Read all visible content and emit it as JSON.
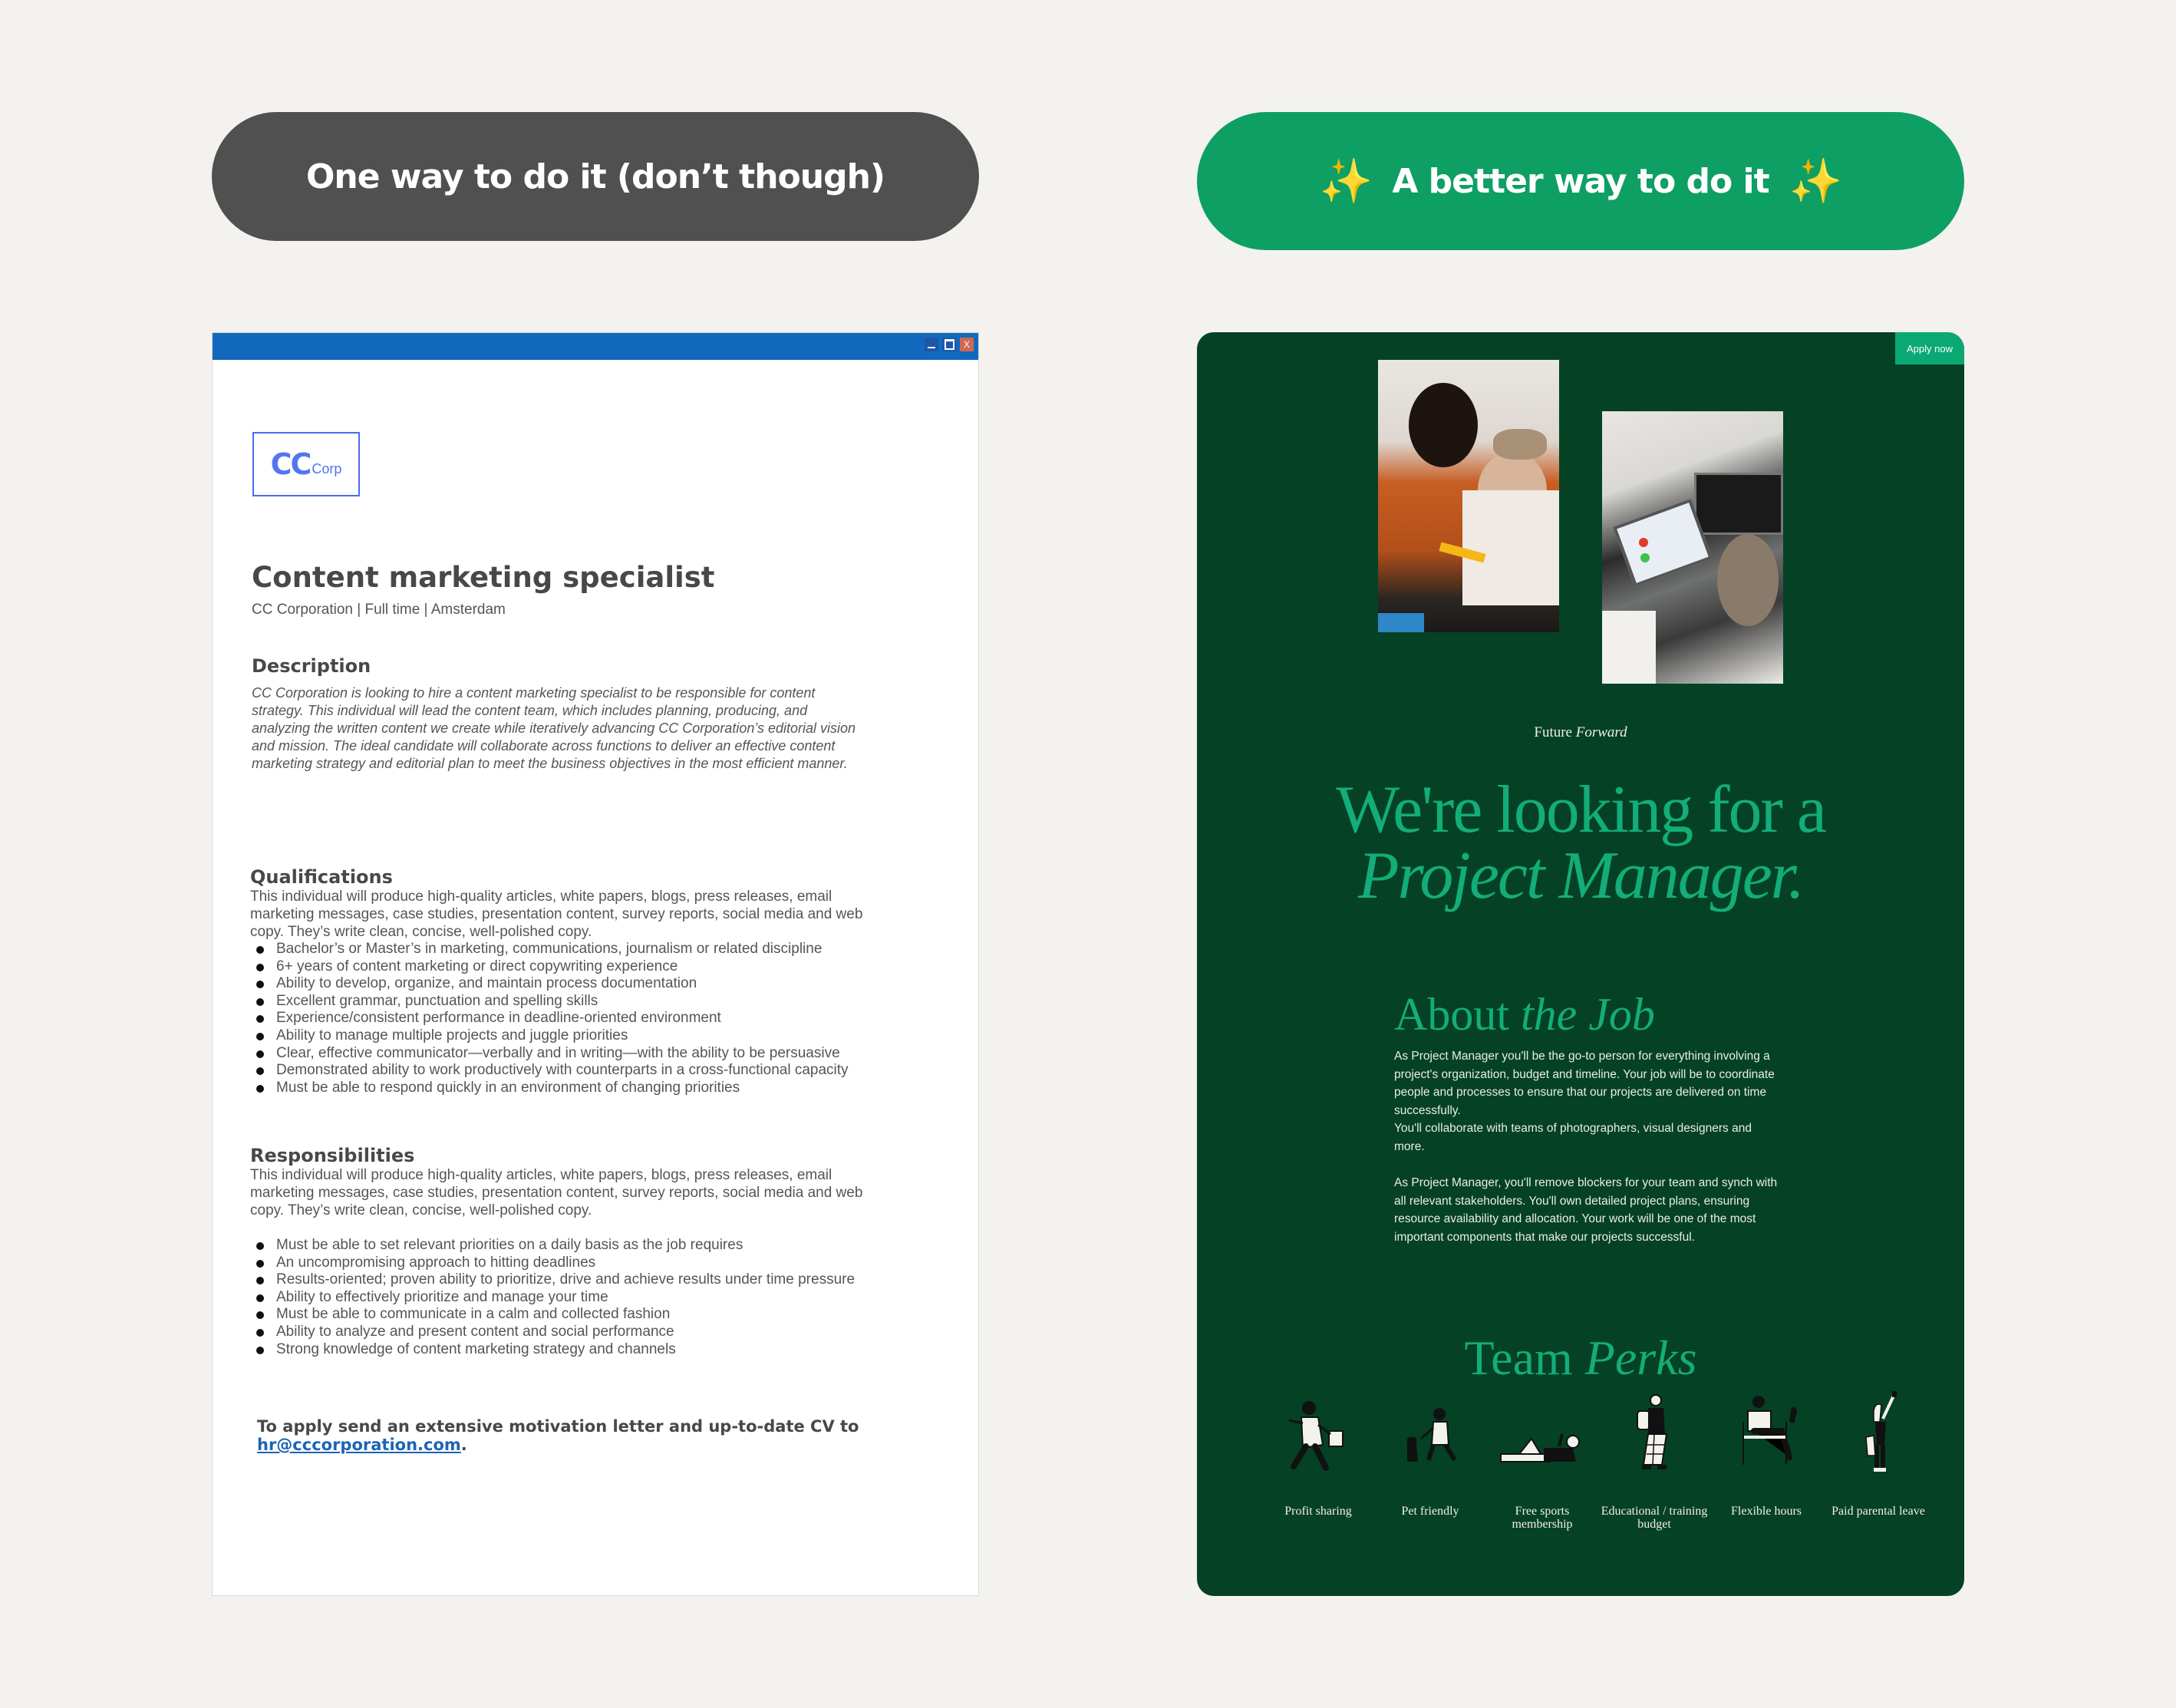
{
  "header": {
    "bad_label": "One way to do it (don’t though)",
    "good_label": "A better way to do it",
    "sparkle_icon": "✨"
  },
  "left_window": {
    "controls": {
      "minimize": "minimize",
      "maximize": "maximize",
      "close": "X"
    },
    "logo": {
      "main": "CC",
      "sub": "Corp"
    },
    "title": "Content marketing specialist",
    "meta": "CC Corporation | Full time | Amsterdam",
    "description": {
      "heading": "Description",
      "text": "CC Corporation is looking to hire a content marketing specialist to be responsible for content strategy. This individual will lead the content team, which includes planning, producing, and analyzing the written content we create while iteratively advancing  CC Corporation’s editorial vision and mission. The ideal candidate will collaborate across functions to deliver an effective content marketing strategy and editorial plan to meet the business objectives in the most efficient manner."
    },
    "qualifications": {
      "heading": "Qualifications",
      "intro": "This individual will produce high-quality articles, white papers, blogs, press releases, email marketing messages, case studies, presentation content, survey reports, social media and web copy. They’s write clean, concise, well-polished copy.",
      "items": [
        "Bachelor’s or Master’s in marketing, communications, journalism or related discipline",
        "6+ years of content marketing or direct copywriting experience",
        "Ability to develop, organize, and maintain process documentation",
        "Excellent grammar, punctuation and spelling skills",
        "Experience/consistent performance in deadline-oriented environment",
        "Ability to manage multiple projects and juggle priorities",
        "Clear, effective communicator—verbally and in writing—with the ability to be persuasive",
        "Demonstrated ability to work productively with counterparts in a cross-functional capacity",
        "Must be able to respond quickly in an environment of changing priorities"
      ]
    },
    "responsibilities": {
      "heading": "Responsibilities",
      "intro": "This individual will produce high-quality articles, white papers, blogs, press releases, email marketing messages, case studies, presentation content, survey reports, social media and web copy. They’s write clean, concise, well-polished copy.",
      "items": [
        "Must be able to set relevant priorities on a daily basis as the job requires",
        "An uncompromising approach to hitting deadlines",
        "Results-oriented; proven ability to prioritize, drive and achieve results under time pressure",
        "Ability to effectively prioritize and manage your time",
        "Must be able to communicate in a calm and collected fashion",
        "Ability to analyze and present content and social performance",
        "Strong knowledge of content marketing strategy and channels"
      ]
    },
    "apply": {
      "text": "To apply send an extensive motivation letter and up-to-date CV to",
      "email": "hr@cccorporation.com",
      "suffix": "."
    }
  },
  "right_page": {
    "apply_button": "Apply now",
    "tagline_plain": "Future",
    "tagline_italic": "Forward",
    "hero_line1": "We're looking for a",
    "hero_line2": "Project Manager.",
    "about": {
      "heading_plain": "About",
      "heading_italic": "the Job",
      "para1": "As Project Manager you'll be the go-to person for everything involving a project's organization, budget and timeline. Your job will be to coordinate people and processes to ensure that our projects are delivered on time successfully.",
      "para1b": "You'll collaborate with teams of photographers, visual designers and more.",
      "para2": "As Project Manager, you'll remove blockers for your team and synch with all relevant stakeholders. You'll own detailed project plans, ensuring resource availability and allocation. Your work will be one of the most important components that make our projects successful."
    },
    "perks": {
      "heading_plain": "Team",
      "heading_italic": "Perks",
      "items": [
        {
          "label": "Profit sharing",
          "icon": "person-running-with-bag-icon"
        },
        {
          "label": "Pet friendly",
          "icon": "person-with-cat-icon"
        },
        {
          "label": "Free sports membership",
          "icon": "person-lying-down-icon"
        },
        {
          "label": "Educational / training budget",
          "icon": "person-walking-with-backpack-icon"
        },
        {
          "label": "Flexible hours",
          "icon": "person-sitting-icon"
        },
        {
          "label": "Paid parental leave",
          "icon": "person-taking-selfie-icon"
        }
      ]
    }
  },
  "colors": {
    "bad_pill": "#505050",
    "good_pill": "#0e9f64",
    "titlebar": "#1169bd",
    "page_bg": "#054125",
    "accent_green": "#13ad79",
    "link": "#1c64b6"
  }
}
